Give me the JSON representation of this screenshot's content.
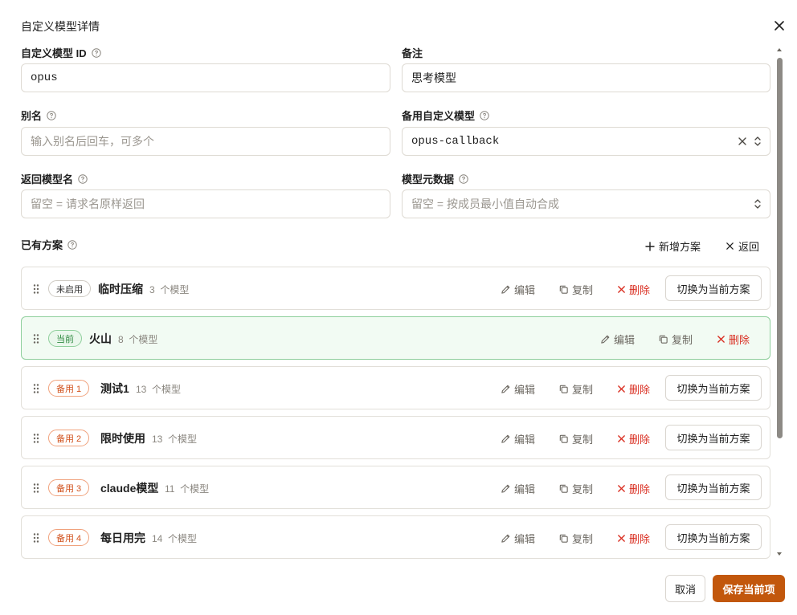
{
  "dialog": {
    "title": "自定义模型详情"
  },
  "form": {
    "model_id": {
      "label": "自定义模型 ID",
      "value": "opus"
    },
    "remark": {
      "label": "备注",
      "value": "思考模型"
    },
    "alias": {
      "label": "别名",
      "placeholder": "输入别名后回车，可多个"
    },
    "fallback_model": {
      "label": "备用自定义模型",
      "value": "opus-callback"
    },
    "return_name": {
      "label": "返回模型名",
      "placeholder": "留空 = 请求名原样返回"
    },
    "metadata": {
      "label": "模型元数据",
      "placeholder": "留空 = 按成员最小值自动合成"
    }
  },
  "plans": {
    "label": "已有方案",
    "add_label": "新增方案",
    "back_label": "返回",
    "edit_label": "编辑",
    "copy_label": "复制",
    "delete_label": "删除",
    "switch_label": "切换为当前方案",
    "items": [
      {
        "badge": "未启用",
        "name": "临时压缩",
        "count": "3",
        "unit": "个模型"
      },
      {
        "badge": "当前",
        "name": "火山",
        "count": "8",
        "unit": "个模型"
      },
      {
        "badge": "备用 1",
        "name": "测试1",
        "count": "13",
        "unit": "个模型"
      },
      {
        "badge": "备用 2",
        "name": "限时使用",
        "count": "13",
        "unit": "个模型"
      },
      {
        "badge": "备用 3",
        "name": "claude模型",
        "count": "11",
        "unit": "个模型"
      },
      {
        "badge": "备用 4",
        "name": "每日用完",
        "count": "14",
        "unit": "个模型"
      }
    ]
  },
  "footer": {
    "cancel_label": "取消",
    "save_label": "保存当前项"
  },
  "colors": {
    "primary": "#c2570c",
    "current_green": "#2f8a40",
    "backup_orange": "#d2531f",
    "danger": "#d92d20"
  }
}
